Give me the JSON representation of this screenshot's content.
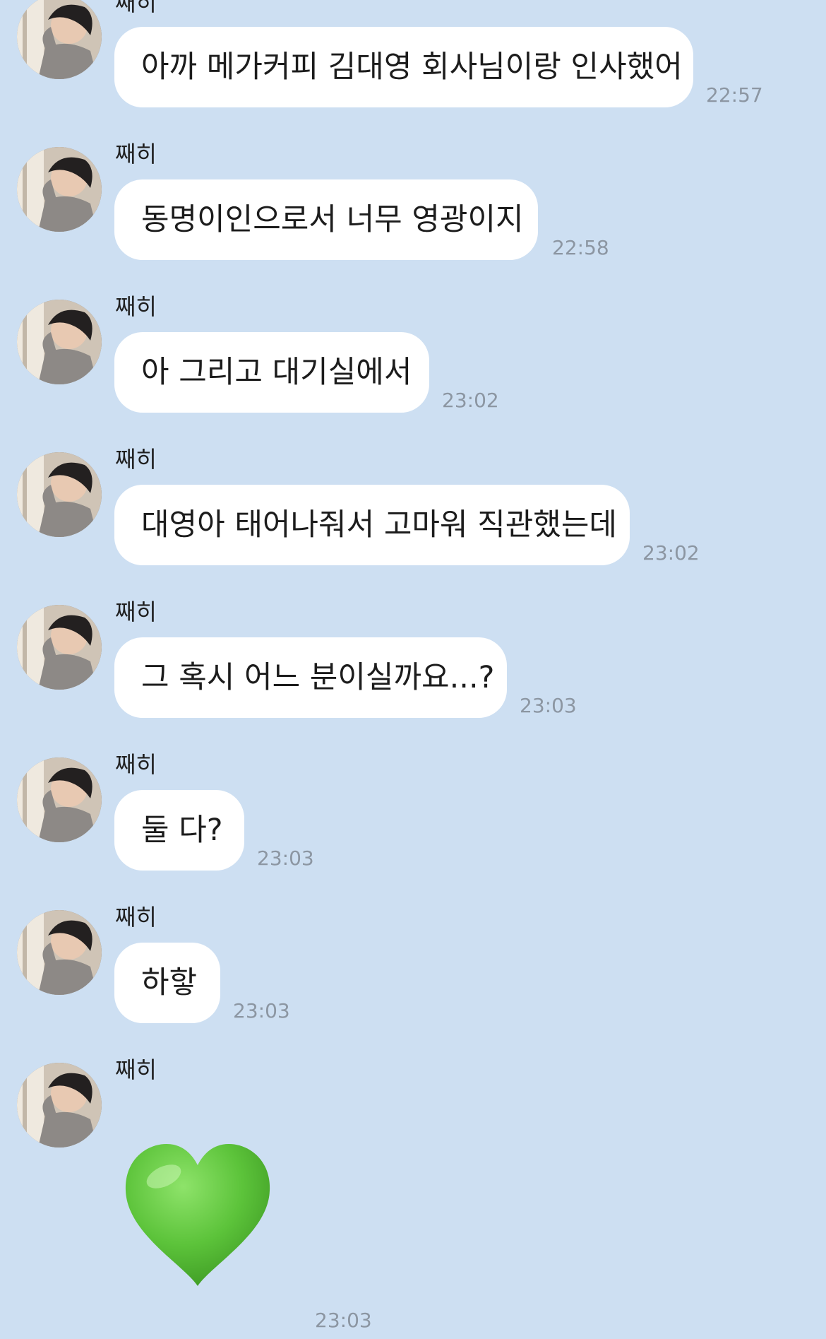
{
  "sender_name": "째히",
  "messages": [
    {
      "text": "아까 메가커피 김대영 회사님이랑 인사했어",
      "time": "22:57"
    },
    {
      "text": "동명이인으로서 너무 영광이지",
      "time": "22:58"
    },
    {
      "text": "아 그리고 대기실에서",
      "time": "23:02"
    },
    {
      "text": "대영아 태어나줘서 고마워 직관했는데",
      "time": "23:02"
    },
    {
      "text": "그 혹시 어느 분이실까요...?",
      "time": "23:03"
    },
    {
      "text": "둘 다?",
      "time": "23:03"
    },
    {
      "text": "하핳",
      "time": "23:03"
    },
    {
      "text": "",
      "time": "23:03",
      "emoji": "green-heart"
    }
  ],
  "colors": {
    "background": "#cddff2",
    "bubble": "#ffffff",
    "time_text": "#8c96a2",
    "heart": "#5cc33a"
  }
}
